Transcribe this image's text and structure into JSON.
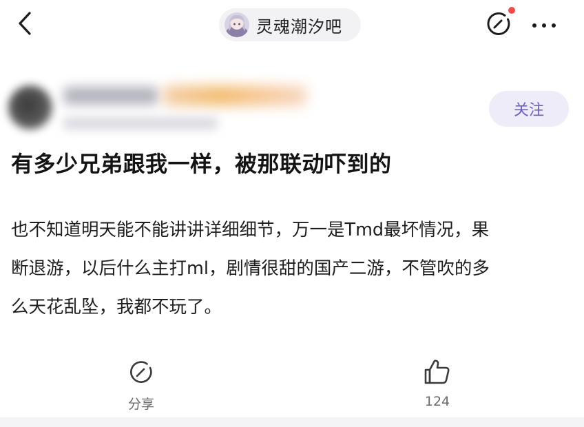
{
  "header": {
    "back_icon": "chevron-left-icon",
    "forum_name": "灵魂潮汐吧",
    "share_icon": "share-icon",
    "more_icon": "more-horizontal-icon"
  },
  "author": {
    "follow_label": "关注"
  },
  "post": {
    "title": "有多少兄弟跟我一样，被那联动吓到的",
    "body_lines": [
      "也不知道明天能不能讲讲详细细节，万一是Tmd最坏情况，果",
      "断退游，以后什么主打ml，剧情很甜的国产二游，不管吹的多",
      "么天花乱坠，我都不玩了。"
    ]
  },
  "actions": {
    "share_label": "分享",
    "like_count": "124"
  },
  "colors": {
    "accent_purple": "#6a5fc8",
    "follow_bg": "#eeecf8",
    "notify_red": "#f04a4a",
    "icon_dark": "#1c1c1e",
    "action_icon": "#3a3a3c"
  }
}
